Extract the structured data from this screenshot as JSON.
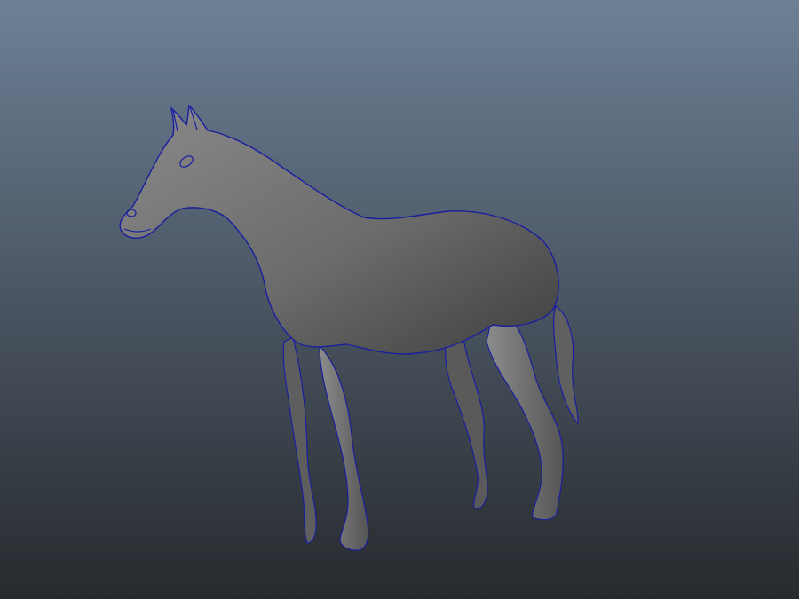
{
  "viewport": {
    "background_top": "#6d8096",
    "background_bottom": "#272a2e"
  },
  "model": {
    "subject": "horse",
    "display_mode": "wireframe-on-shaded",
    "shading_color": "#707070",
    "wireframe_color": "#1a1f9e"
  }
}
